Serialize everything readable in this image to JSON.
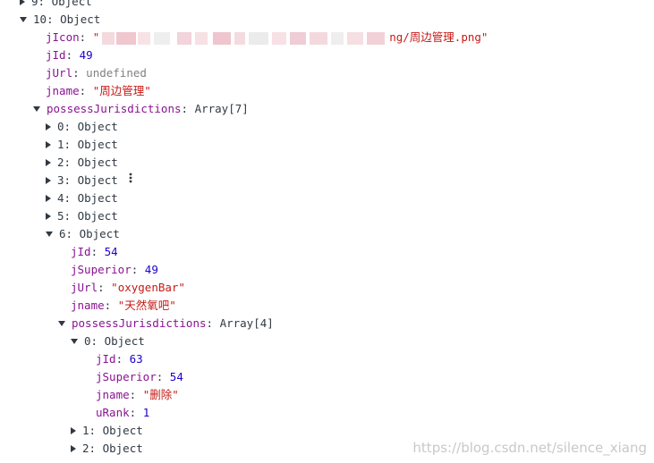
{
  "tree": {
    "r0_idx": "9",
    "r0_type": "Object",
    "r1_idx": "10",
    "r1_type": "Object",
    "jIcon_key": "jIcon",
    "jIcon_open": "\"",
    "jIcon_tail": "ng/周边管理.png\"",
    "jId_key": "jId",
    "jId_val": "49",
    "jUrl_key": "jUrl",
    "jUrl_val": "undefined",
    "jname_key": "jname",
    "jname_val": "\"周边管理\"",
    "pj_key": "possessJurisdictions",
    "pj_type": "Array[7]",
    "children": [
      {
        "idx": "0",
        "type": "Object"
      },
      {
        "idx": "1",
        "type": "Object"
      },
      {
        "idx": "2",
        "type": "Object"
      },
      {
        "idx": "3",
        "type": "Object"
      },
      {
        "idx": "4",
        "type": "Object"
      },
      {
        "idx": "5",
        "type": "Object"
      }
    ],
    "c6_idx": "6",
    "c6_type": "Object",
    "c6": {
      "jId_key": "jId",
      "jId_val": "54",
      "jSuperior_key": "jSuperior",
      "jSuperior_val": "49",
      "jUrl_key": "jUrl",
      "jUrl_val": "\"oxygenBar\"",
      "jname_key": "jname",
      "jname_val": "\"天然氧吧\"",
      "pj_key": "possessJurisdictions",
      "pj_type": "Array[4]",
      "g0_idx": "0",
      "g0_type": "Object",
      "g0": {
        "jId_key": "jId",
        "jId_val": "63",
        "jSuperior_key": "jSuperior",
        "jSuperior_val": "54",
        "jname_key": "jname",
        "jname_val": "\"删除\"",
        "uRank_key": "uRank",
        "uRank_val": "1"
      },
      "g1_idx": "1",
      "g1_type": "Object",
      "g2_idx": "2",
      "g2_type": "Object"
    }
  },
  "watermark": "https://blog.csdn.net/silence_xiang",
  "colors": {
    "key": "#881391",
    "number": "#1c00cf",
    "string": "#c41a16",
    "undefined": "#808080",
    "text": "#303942"
  },
  "icons": {
    "expanded": "triangle-down-icon",
    "collapsed": "triangle-right-icon",
    "more": "vertical-ellipsis-icon"
  }
}
